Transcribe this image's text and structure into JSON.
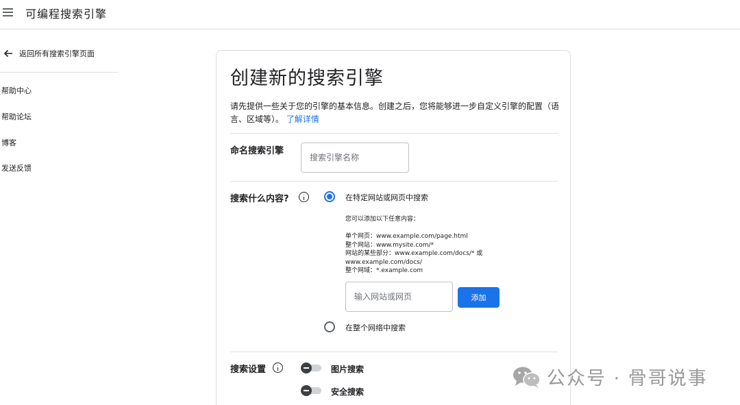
{
  "app": {
    "title": "可编程搜索引擎"
  },
  "sidebar": {
    "back_label": "返回所有搜索引擎页面",
    "items": [
      {
        "label": "帮助中心"
      },
      {
        "label": "帮助论坛"
      },
      {
        "label": "博客"
      },
      {
        "label": "发送反馈"
      }
    ]
  },
  "card": {
    "title": "创建新的搜索引擎",
    "description": "请先提供一些关于您的引擎的基本信息。创建之后，您将能够进一步自定义引擎的配置（语言、区域等）。",
    "learn_more": "了解详情",
    "name_section": {
      "label": "命名搜索引擎",
      "placeholder": "搜索引擎名称",
      "value": ""
    },
    "content_section": {
      "label": "搜索什么内容?",
      "options": [
        {
          "label": "在特定网站或网页中搜索",
          "selected": true
        },
        {
          "label": "在整个网络中搜索",
          "selected": false
        }
      ],
      "hint_intro": "您可以添加以下任意内容：",
      "hint_lines": [
        "单个网页：www.example.com/page.html",
        "整个网站：www.mysite.com/*",
        "网站的某些部分：www.example.com/docs/* 或",
        "www.example.com/docs/",
        "整个网域：*.example.com"
      ],
      "url_placeholder": "输入网站或网页",
      "url_value": "",
      "add_label": "添加"
    },
    "settings_section": {
      "label": "搜索设置",
      "toggles": [
        {
          "label": "图片搜索",
          "enabled": false
        },
        {
          "label": "安全搜索",
          "enabled": false
        }
      ]
    }
  },
  "watermark": {
    "text": "公众号 · 骨哥说事"
  },
  "colors": {
    "accent": "#1a73e8",
    "divider": "#e0e0e0",
    "toggle_thumb": "#3c4043"
  }
}
